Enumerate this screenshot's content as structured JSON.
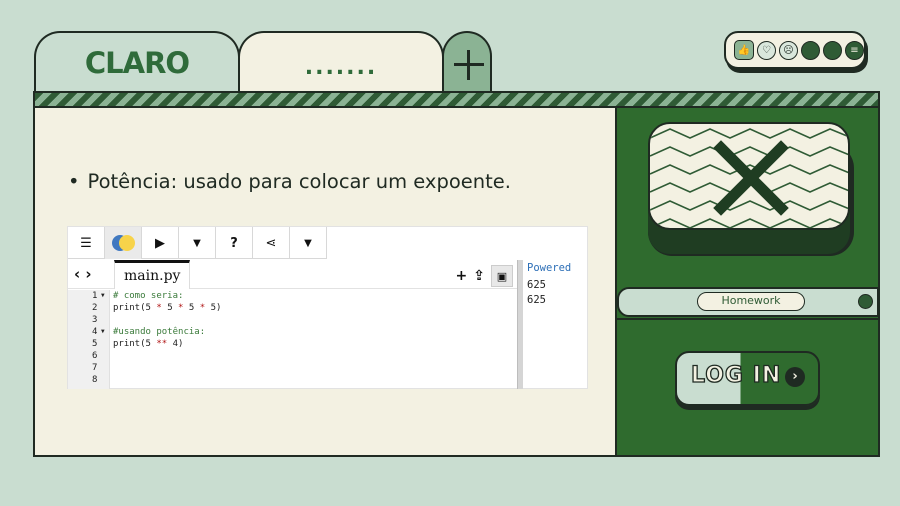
{
  "tabs": {
    "claro_label": "CLARO",
    "dots_label": ".......",
    "add_icon": "plus-icon"
  },
  "reactions": [
    "thumbs-up-icon",
    "heart-icon",
    "angry-face-icon",
    "dark-circle-icon",
    "dark-circle-icon",
    "menu-circle-icon"
  ],
  "main": {
    "bullet_text": "Potência: usado para colocar um expoente."
  },
  "editor": {
    "toolbar": [
      "menu-icon",
      "python-logo-icon",
      "run-icon",
      "dropdown-icon",
      "help-icon",
      "share-icon",
      "dropdown-icon"
    ],
    "file_name": "main.py",
    "line_numbers": [
      "1",
      "2",
      "3",
      "4",
      "5",
      "6",
      "7",
      "8"
    ],
    "code_lines": [
      {
        "text": "# como seria:",
        "kind": "comment"
      },
      {
        "text": "print(5 * 5 * 5 * 5)",
        "kind": "code"
      },
      {
        "text": "",
        "kind": "code"
      },
      {
        "text": "#usando potência:",
        "kind": "comment"
      },
      {
        "text": "print(5 ** 4)",
        "kind": "code"
      },
      {
        "text": "",
        "kind": "code"
      },
      {
        "text": "",
        "kind": "code"
      },
      {
        "text": "",
        "kind": "code"
      }
    ],
    "console": {
      "powered": "Powered",
      "output": [
        "625",
        "625"
      ]
    }
  },
  "sidebar": {
    "homework_label": "Homework",
    "login_label": "LOG IN",
    "login_arrow": "›"
  },
  "colors": {
    "dark_green": "#2f6b2e",
    "mint": "#c9ddd0",
    "cream": "#f3f1e2"
  }
}
